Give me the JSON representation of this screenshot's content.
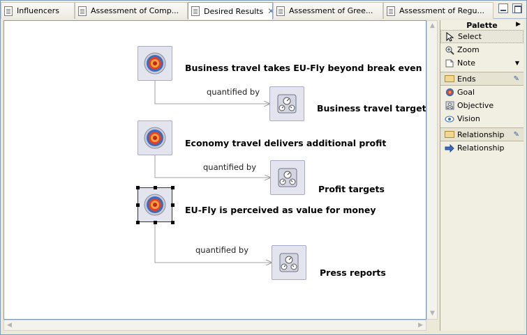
{
  "tabs": [
    {
      "label": "Influencers",
      "active": false,
      "closable": false
    },
    {
      "label": "Assessment of Comp...",
      "active": false,
      "closable": false
    },
    {
      "label": "Desired Results",
      "active": true,
      "closable": true
    },
    {
      "label": "Assessment of Gree...",
      "active": false,
      "closable": false
    },
    {
      "label": "Assessment of Regu...",
      "active": false,
      "closable": false
    }
  ],
  "diagram": {
    "goals": [
      {
        "label": "Business travel takes EU-Fly beyond break even",
        "selected": false
      },
      {
        "label": "Economy travel delivers additional profit",
        "selected": false
      },
      {
        "label": "EU-Fly is perceived as value for money",
        "selected": true
      }
    ],
    "objectives": [
      {
        "label": "Business travel targets"
      },
      {
        "label": "Profit targets"
      },
      {
        "label": "Press reports"
      }
    ],
    "edges": [
      {
        "label": "quantified by"
      },
      {
        "label": "quantified by"
      },
      {
        "label": "quantified by"
      }
    ]
  },
  "palette": {
    "title": "Palette",
    "tools": [
      {
        "label": "Select",
        "icon": "cursor-icon"
      },
      {
        "label": "Zoom",
        "icon": "zoom-icon"
      },
      {
        "label": "Note",
        "icon": "note-icon"
      }
    ],
    "groups": [
      {
        "label": "Ends",
        "items": [
          {
            "label": "Goal",
            "icon": "goal-icon"
          },
          {
            "label": "Objective",
            "icon": "objective-icon"
          },
          {
            "label": "Vision",
            "icon": "vision-icon"
          }
        ]
      },
      {
        "label": "Relationship",
        "items": [
          {
            "label": "Relationship",
            "icon": "arrow-icon"
          }
        ]
      }
    ]
  },
  "colors": {
    "accent": "#8ba2c9",
    "node_fill": "#e3e4ee",
    "target_red": "#e0422a",
    "target_blue": "#3a6bbf"
  }
}
